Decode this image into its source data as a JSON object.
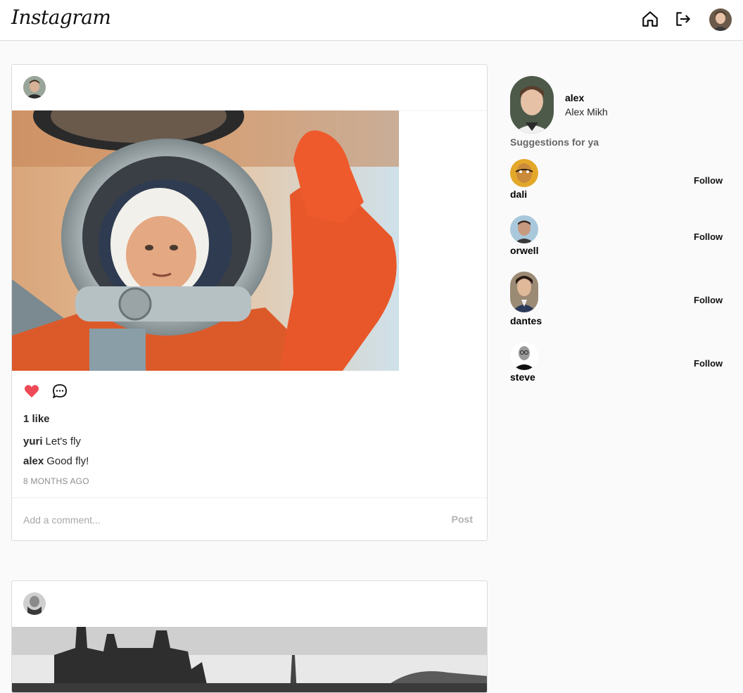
{
  "header": {
    "logo": "Instagram",
    "icons": [
      "home-icon",
      "logout-icon",
      "avatar"
    ]
  },
  "posts": [
    {
      "likes": "1 like",
      "comments": [
        {
          "user": "yuri",
          "text": "Let's fly"
        },
        {
          "user": "alex",
          "text": "Good fly!"
        }
      ],
      "time": "8 months ago",
      "comment_placeholder": "Add a comment...",
      "post_label": "Post",
      "liked_color": "#ed4956"
    }
  ],
  "sidebar": {
    "user": {
      "username": "alex",
      "full_name": "Alex Mikh"
    },
    "suggestions_title": "Suggestions for ya",
    "suggestions": [
      {
        "username": "dali",
        "follow_label": "Follow"
      },
      {
        "username": "orwell",
        "follow_label": "Follow"
      },
      {
        "username": "dantes",
        "follow_label": "Follow"
      },
      {
        "username": "steve",
        "follow_label": "Follow"
      }
    ]
  }
}
